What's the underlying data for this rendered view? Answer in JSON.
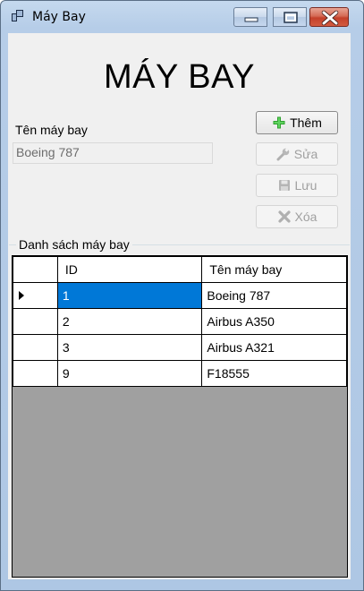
{
  "window": {
    "title": "Máy Bay",
    "controls": {
      "minimize": "minimize-icon",
      "maximize": "maximize-icon",
      "close": "close-icon"
    }
  },
  "form": {
    "heading": "MÁY BAY",
    "name_label": "Tên máy bay",
    "name_value": "Boeing 787",
    "name_enabled": false
  },
  "buttons": {
    "add": {
      "label": "Thêm",
      "icon": "plus-icon",
      "enabled": true
    },
    "edit": {
      "label": "Sửa",
      "icon": "wrench-icon",
      "enabled": false
    },
    "save": {
      "label": "Lưu",
      "icon": "floppy-disk-icon",
      "enabled": false
    },
    "delete": {
      "label": "Xóa",
      "icon": "x-icon",
      "enabled": false
    }
  },
  "list": {
    "group_label": "Danh sách máy bay",
    "columns": [
      "ID",
      "Tên máy bay"
    ],
    "rows": [
      {
        "id": "1",
        "name": "Boeing 787",
        "selected": true
      },
      {
        "id": "2",
        "name": "Airbus A350",
        "selected": false
      },
      {
        "id": "3",
        "name": "Airbus A321",
        "selected": false
      },
      {
        "id": "9",
        "name": "F18555",
        "selected": false
      }
    ]
  },
  "colors": {
    "selection": "#0078d7",
    "grid_background": "#a0a0a0",
    "add_icon": "#2fa12f",
    "close_button": "#c4402a"
  }
}
